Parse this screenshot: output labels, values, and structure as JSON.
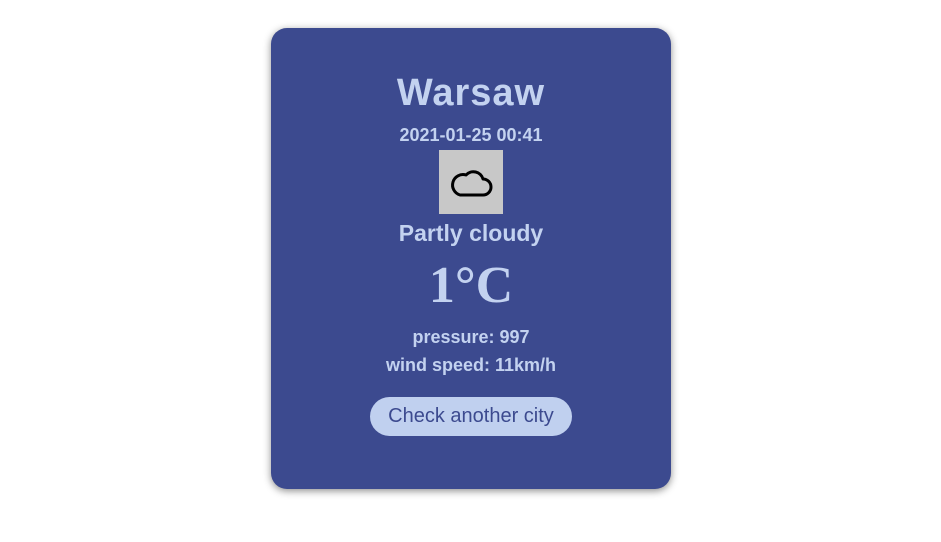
{
  "weather": {
    "city": "Warsaw",
    "datetime": "2021-01-25 00:41",
    "icon": "cloud-icon",
    "condition": "Partly cloudy",
    "temperature": "1°C",
    "pressure_label": "pressure: 997",
    "wind_label": "wind speed: 11km/h"
  },
  "actions": {
    "check_another_label": "Check another city"
  },
  "colors": {
    "card_background": "#3c4a8f",
    "text": "#c3d2f0",
    "button_background": "#c0d0ef",
    "icon_background": "#c8c8c8"
  }
}
